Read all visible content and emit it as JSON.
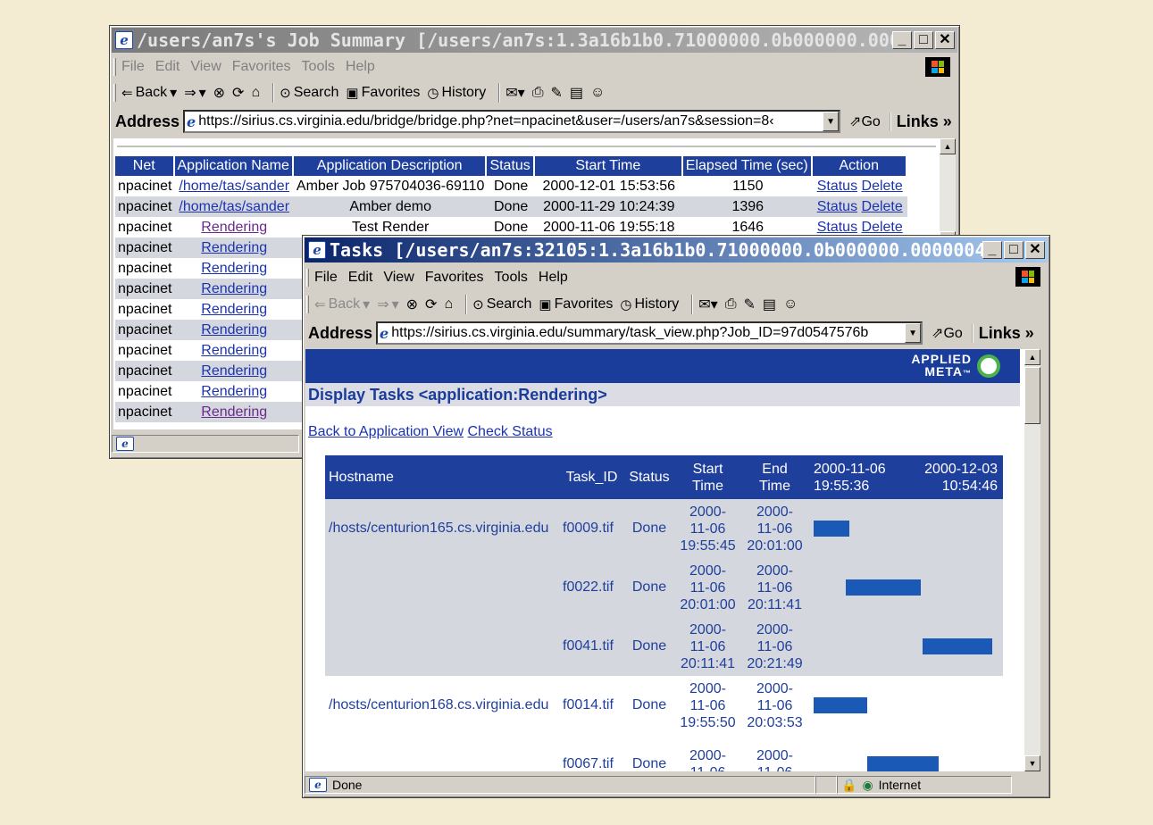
{
  "window1": {
    "title": "/users/an7s's Job Summary [/users/an7s:1.3a16b1b0.71000000.0b000000.0000...",
    "menu": [
      "File",
      "Edit",
      "View",
      "Favorites",
      "Tools",
      "Help"
    ],
    "toolbar": {
      "back": "Back",
      "search": "Search",
      "favorites": "Favorites",
      "history": "History"
    },
    "address_label": "Address",
    "address_url": "https://sirius.cs.virginia.edu/bridge/bridge.php?net=npacinet&user=/users/an7s&session=8‹",
    "go_label": "Go",
    "links_label": "Links",
    "table": {
      "headers": [
        "Net",
        "Application Name",
        "Application Description",
        "Status",
        "Start Time",
        "Elapsed Time (sec)",
        "Action"
      ],
      "rows": [
        {
          "net": "npacinet",
          "app": "/home/tas/sander",
          "desc": "Amber Job 975704036-69110",
          "status": "Done",
          "start": "2000-12-01 15:53:56",
          "elapsed": "1150",
          "a1": "Status",
          "a2": "Delete"
        },
        {
          "net": "npacinet",
          "app": "/home/tas/sander",
          "desc": "Amber demo",
          "status": "Done",
          "start": "2000-11-29 10:24:39",
          "elapsed": "1396",
          "a1": "Status",
          "a2": "Delete"
        },
        {
          "net": "npacinet",
          "app": "Rendering",
          "desc": "Test Render",
          "status": "Done",
          "start": "2000-11-06 19:55:18",
          "elapsed": "1646",
          "a1": "Status",
          "a2": "Delete"
        },
        {
          "net": "npacinet",
          "app": "Rendering"
        },
        {
          "net": "npacinet",
          "app": "Rendering"
        },
        {
          "net": "npacinet",
          "app": "Rendering"
        },
        {
          "net": "npacinet",
          "app": "Rendering"
        },
        {
          "net": "npacinet",
          "app": "Rendering"
        },
        {
          "net": "npacinet",
          "app": "Rendering"
        },
        {
          "net": "npacinet",
          "app": "Rendering"
        },
        {
          "net": "npacinet",
          "app": "Rendering"
        },
        {
          "net": "npacinet",
          "app": "Rendering"
        }
      ]
    }
  },
  "window2": {
    "title": "Tasks [/users/an7s:32105:1.3a16b1b0.71000000.0b000000.0000004...",
    "menu": [
      "File",
      "Edit",
      "View",
      "Favorites",
      "Tools",
      "Help"
    ],
    "toolbar": {
      "back": "Back",
      "search": "Search",
      "favorites": "Favorites",
      "history": "History"
    },
    "address_label": "Address",
    "address_url": "https://sirius.cs.virginia.edu/summary/task_view.php?Job_ID=97d0547576b",
    "go_label": "Go",
    "links_label": "Links",
    "brand_line1": "APPLIED",
    "brand_line2": "META",
    "brand_tm": "™",
    "heading": "Display Tasks <application:Rendering>",
    "link_back": "Back to Application View",
    "link_check": "Check Status",
    "table": {
      "headers": {
        "hostname": "Hostname",
        "task_id": "Task_ID",
        "status": "Status",
        "start": "Start Time",
        "end": "End Time",
        "range_start": "2000-11-06 19:55:36",
        "range_end": "2000-12-03 10:54:46"
      },
      "rows": [
        {
          "host": "/hosts/centurion165.cs.virginia.edu",
          "task": "f0009.tif",
          "status": "Done",
          "start": "2000- 11-06 19:55:45",
          "end": "2000- 11-06 20:01:00",
          "bar_start": 0.0,
          "bar_width": 0.2
        },
        {
          "host": "",
          "task": "f0022.tif",
          "status": "Done",
          "start": "2000- 11-06 20:01:00",
          "end": "2000- 11-06 20:11:41",
          "bar_start": 0.18,
          "bar_width": 0.42
        },
        {
          "host": "",
          "task": "f0041.tif",
          "status": "Done",
          "start": "2000- 11-06 20:11:41",
          "end": "2000- 11-06 20:21:49",
          "bar_start": 0.61,
          "bar_width": 0.39
        },
        {
          "host": "/hosts/centurion168.cs.virginia.edu",
          "task": "f0014.tif",
          "status": "Done",
          "start": "2000- 11-06 19:55:50",
          "end": "2000- 11-06 20:03:53",
          "bar_start": 0.0,
          "bar_width": 0.3
        },
        {
          "host": "",
          "task": "f0067.tif",
          "status": "Done",
          "start": "2000- 11-06",
          "end": "2000- 11-06",
          "bar_start": 0.3,
          "bar_width": 0.4
        }
      ]
    },
    "status_text": "Done",
    "zone_text": "Internet"
  }
}
